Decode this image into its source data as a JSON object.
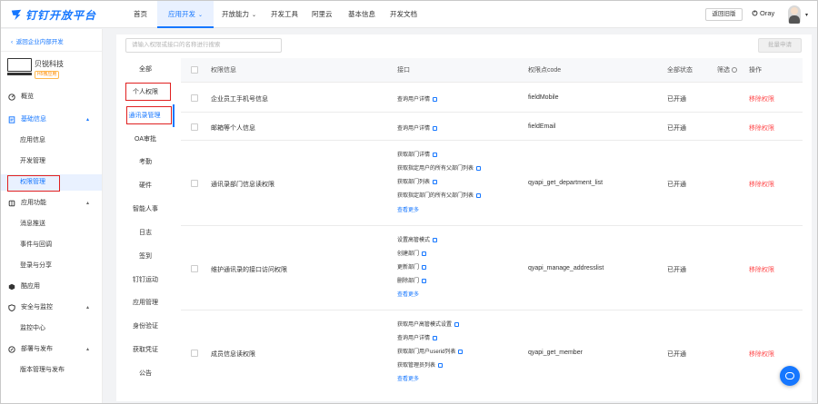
{
  "brand": {
    "name": "钉钉开放平台",
    "accent": "#1677ff",
    "danger": "#ff4d4f",
    "highlight": "#e02020"
  },
  "topnav": {
    "items": [
      "首页",
      "应用开发",
      "开放能力",
      "开发工具",
      "阿里云",
      "基本信息",
      "开发文档"
    ],
    "active_index": 1,
    "old_version": "返回旧版",
    "user": "Oray"
  },
  "sidebar": {
    "back": "返回企业内部开发",
    "app_name": "贝锐科技",
    "app_badge": "H5微应用",
    "items": [
      {
        "label": "概览",
        "icon": "gauge-icon"
      },
      {
        "label": "基础信息",
        "icon": "doc-icon"
      },
      {
        "label": "应用信息"
      },
      {
        "label": "开发管理"
      },
      {
        "label": "权限管理"
      },
      {
        "label": "应用功能",
        "icon": "puzzle-icon"
      },
      {
        "label": "消息推送"
      },
      {
        "label": "事件与回调"
      },
      {
        "label": "登录与分享"
      },
      {
        "label": "酷应用",
        "icon": "cube-icon"
      },
      {
        "label": "安全与监控",
        "icon": "shield-icon"
      },
      {
        "label": "监控中心"
      },
      {
        "label": "部署与发布",
        "icon": "rocket-icon"
      },
      {
        "label": "版本管理与发布"
      }
    ]
  },
  "search": {
    "placeholder": "请输入权限或接口的名称进行搜索"
  },
  "batch_apply": "批量申请",
  "categories": [
    "全部",
    "个人权限",
    "通讯录管理",
    "OA审批",
    "考勤",
    "硬件",
    "智能人事",
    "日志",
    "签到",
    "钉钉运动",
    "应用管理",
    "身份验证",
    "获取凭证",
    "公告"
  ],
  "table": {
    "headers": {
      "permission": "权限信息",
      "interface": "接口",
      "code": "权限点code",
      "status": "全部状态",
      "filter": "筛选",
      "action": "操作"
    },
    "more_label": "查看更多",
    "rows": [
      {
        "name": "企业员工手机号信息",
        "interfaces": [
          "查询用户详情"
        ],
        "code": "fieldMobile",
        "status": "已开通",
        "action": "移除权限"
      },
      {
        "name": "邮箱等个人信息",
        "interfaces": [
          "查询用户详情"
        ],
        "code": "fieldEmail",
        "status": "已开通",
        "action": "移除权限"
      },
      {
        "name": "通讯录部门信息读权限",
        "interfaces": [
          "获取部门详情",
          "获取指定用户的所有父部门列表",
          "获取部门列表",
          "获取指定部门的所有父部门列表"
        ],
        "more": true,
        "code": "qyapi_get_department_list",
        "status": "已开通",
        "action": "移除权限"
      },
      {
        "name": "维护通讯录的接口访问权限",
        "interfaces": [
          "设置高管模式",
          "创建部门",
          "更新部门",
          "删除部门"
        ],
        "more": true,
        "code": "qyapi_manage_addresslist",
        "status": "已开通",
        "action": "移除权限"
      },
      {
        "name": "成员信息读权限",
        "interfaces": [
          "获取用户高管模式设置",
          "查询用户详情",
          "获取部门用户userid列表",
          "获取管理员列表"
        ],
        "more": true,
        "code": "qyapi_get_member",
        "status": "已开通",
        "action": "移除权限"
      }
    ]
  }
}
